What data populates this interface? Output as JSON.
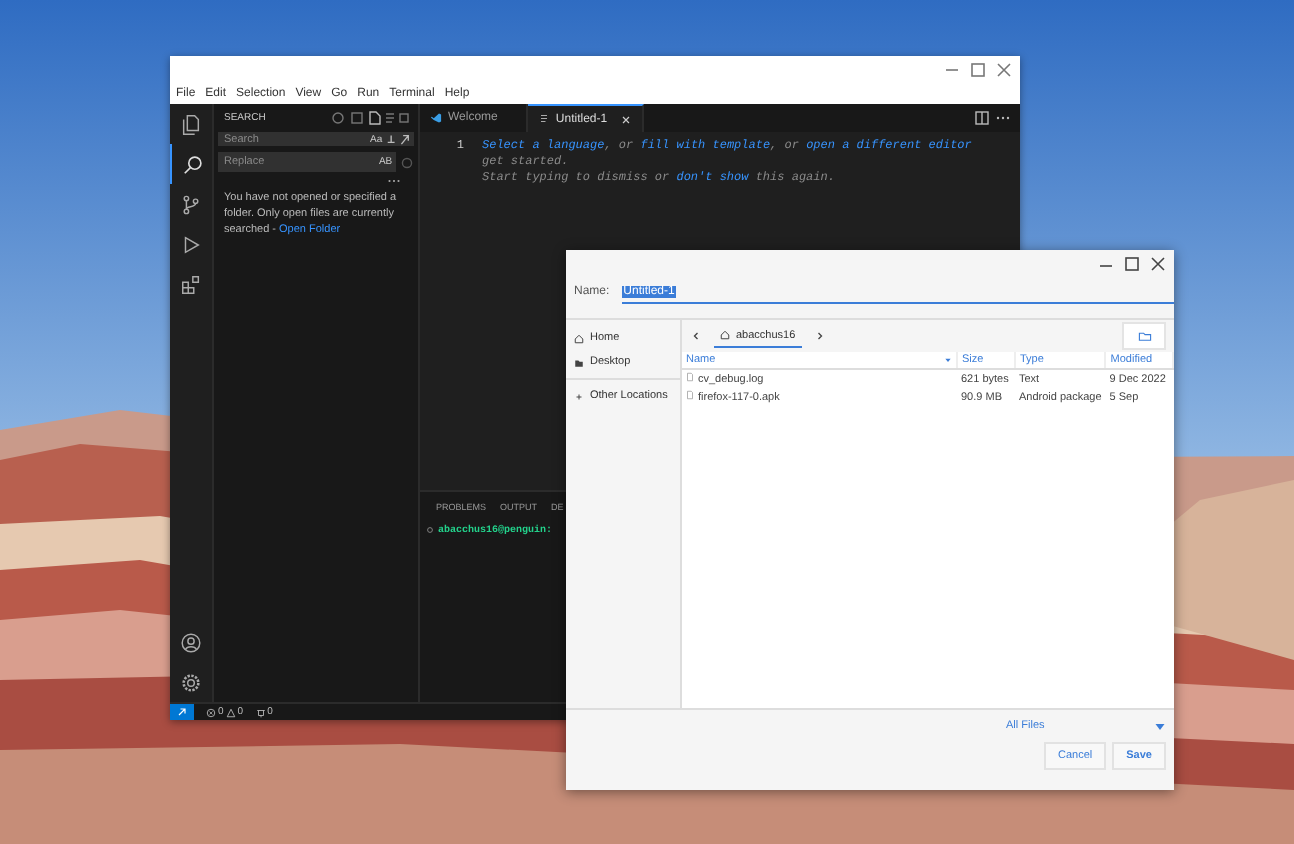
{
  "vscode": {
    "menu": [
      "File",
      "Edit",
      "Selection",
      "View",
      "Go",
      "Run",
      "Terminal",
      "Help"
    ],
    "activity_items": [
      {
        "kind": "files",
        "selected": false
      },
      {
        "kind": "search",
        "selected": true
      },
      {
        "kind": "source-control",
        "selected": false
      },
      {
        "kind": "run",
        "selected": false
      },
      {
        "kind": "extensions",
        "selected": false
      }
    ],
    "sidebar": {
      "title": "SEARCH",
      "search_field": {
        "placeholder": "Search",
        "option": "Aa"
      },
      "replace_field": {
        "placeholder": "Replace",
        "option": "AB"
      },
      "message": "You have not opened or specified a folder. Only open files are currently searched - ",
      "link": "Open Folder"
    },
    "tabs": [
      {
        "label": "Welcome",
        "kind": "welcome",
        "selected": false
      },
      {
        "label": "Untitled-1",
        "kind": "file",
        "selected": true
      }
    ],
    "editor_lines": [
      {
        "number": "1",
        "segments": [
          {
            "kind": "link",
            "text": "Select a language"
          },
          {
            "kind": "plain",
            "text": ", or "
          },
          {
            "kind": "link",
            "text": "fill with template"
          },
          {
            "kind": "plain",
            "text": ", or "
          },
          {
            "kind": "link",
            "text": "open a different editor"
          }
        ]
      },
      {
        "segments": [
          {
            "kind": "plain",
            "text": "get started."
          }
        ]
      },
      {
        "segments": [
          {
            "kind": "plain",
            "text": "Start typing to dismiss or "
          },
          {
            "kind": "link",
            "text": "don't show"
          },
          {
            "kind": "plain",
            "text": " this again."
          }
        ]
      }
    ],
    "panel_tabs": [
      "PROBLEMS",
      "OUTPUT",
      "DE"
    ],
    "terminal_prompt": "abacchus16@penguin:",
    "status_bar": {
      "errors": "0",
      "warnings": "0",
      "ports": "0"
    }
  },
  "save_dialog": {
    "name_label": "Name:",
    "name_value": "Untitled-1",
    "name_selected": true,
    "places": [
      {
        "label": "Home",
        "kind": "home",
        "selected": false
      },
      {
        "label": "Desktop",
        "kind": "folder",
        "selected": false
      },
      {
        "label": "Other Locations",
        "kind": "add",
        "selected": false
      }
    ],
    "path_segment": "abacchus16",
    "columns": [
      {
        "label": "Name",
        "sorted": true
      },
      {
        "label": "Size",
        "sorted": false
      },
      {
        "label": "Type",
        "sorted": false
      },
      {
        "label": "Modified",
        "sorted": false
      }
    ],
    "rows": [
      {
        "cells": [
          "cv_debug.log",
          "621 bytes",
          "Text",
          "9 Dec 2022"
        ]
      },
      {
        "cells": [
          "firefox-117-0.apk",
          "90.9 MB",
          "Android package",
          "5 Sep"
        ]
      }
    ],
    "filter": "All Files",
    "buttons": [
      "Cancel",
      "Save"
    ]
  }
}
